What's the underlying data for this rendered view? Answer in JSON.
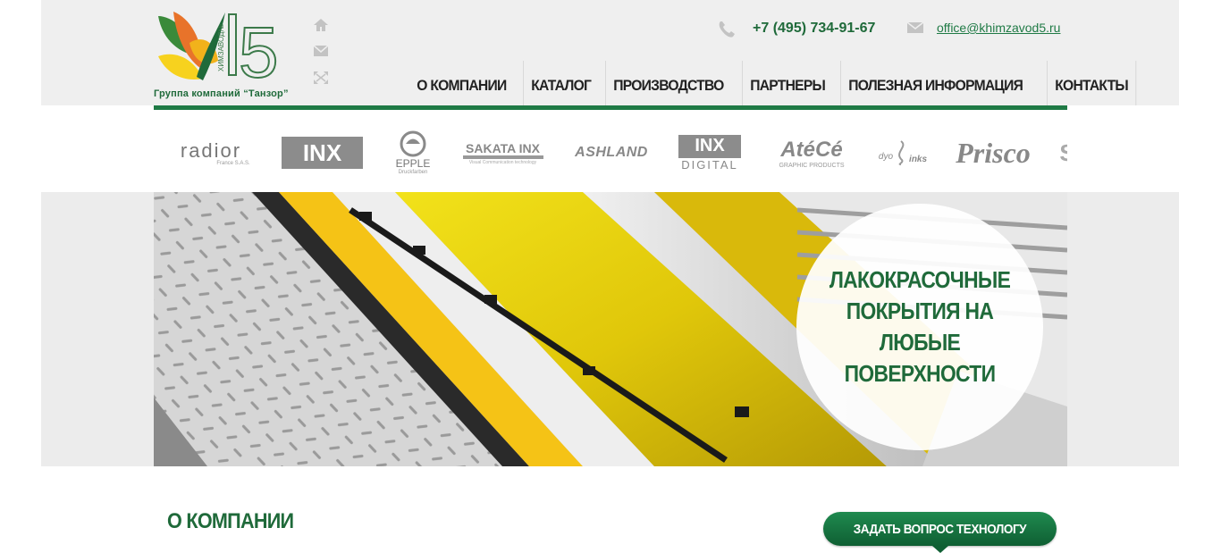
{
  "header": {
    "logo_caption": "Группа компаний “Танзор”",
    "logo_number": "5",
    "logo_vertical_text": "ХИМЗАВОД№",
    "phone": "+7 (495) 734-91-67",
    "email": "office@khimzavod5.ru"
  },
  "icons": [
    "home-icon",
    "mail-icon",
    "expand-icon",
    "phone-icon"
  ],
  "nav": {
    "items": [
      "О КОМПАНИИ",
      "КАТАЛОГ",
      "ПРОИЗВОДСТВО",
      "ПАРТНЕРЫ",
      "ПОЛЕЗНАЯ ИНФОРМАЦИЯ",
      "КОНТАКТЫ"
    ]
  },
  "brands": {
    "radior": "radior",
    "radior_sub": "France S.A.S.",
    "inx": "INX",
    "epple": "EPPLE",
    "epple_sub": "Druckfarben",
    "sakata": "SAKATA INX",
    "sakata_sub": "Visual Communication technology",
    "ashland": "ASHLAND",
    "inx_digital_top": "INX",
    "inx_digital": "DIGITAL",
    "atece": "AtéCé",
    "atece_sub": "GRAPHIC PRODUCTS",
    "dyo": "dyo",
    "dyo_sub": "inks",
    "prisco": "Prisco",
    "partial": "S"
  },
  "hero": {
    "text": "ЛАКОКРАСОЧНЫЕ ПОКРЫТИЯ НА ЛЮБЫЕ ПОВЕРХНОСТИ"
  },
  "main": {
    "section_title": "О КОМПАНИИ",
    "ask_button": "ЗАДАТЬ ВОПРОС ТЕХНОЛОГУ"
  },
  "colors": {
    "brand_green": "#1f6a3a",
    "accent_green": "#1f7a45",
    "header_bg": "#efefef"
  }
}
